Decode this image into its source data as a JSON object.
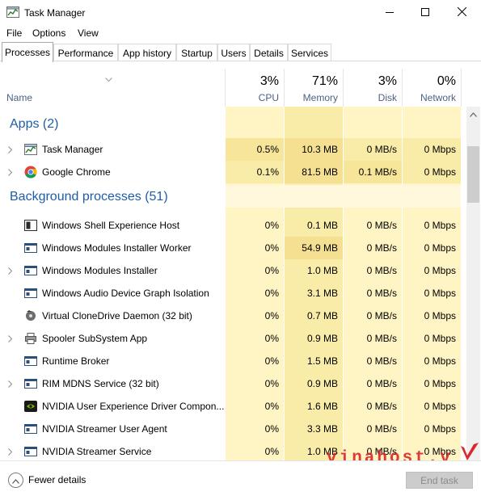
{
  "window": {
    "title": "Task Manager",
    "controls": [
      "minimize",
      "maximize",
      "close"
    ]
  },
  "menu": [
    "File",
    "Options",
    "View"
  ],
  "tabs": [
    {
      "label": "Processes",
      "active": true
    },
    {
      "label": "Performance",
      "active": false
    },
    {
      "label": "App history",
      "active": false
    },
    {
      "label": "Startup",
      "active": false
    },
    {
      "label": "Users",
      "active": false
    },
    {
      "label": "Details",
      "active": false
    },
    {
      "label": "Services",
      "active": false
    }
  ],
  "columns": {
    "name": "Name",
    "cpu": {
      "label": "CPU",
      "percent": "3%"
    },
    "memory": {
      "label": "Memory",
      "percent": "71%"
    },
    "disk": {
      "label": "Disk",
      "percent": "3%"
    },
    "network": {
      "label": "Network",
      "percent": "0%"
    }
  },
  "groups": {
    "apps": "Apps (2)",
    "background": "Background processes (51)"
  },
  "apps": [
    {
      "name": "Task Manager",
      "cpu": "0.5%",
      "memory": "10.3 MB",
      "disk": "0 MB/s",
      "network": "0 Mbps",
      "icon": "task-manager-icon",
      "expandable": true
    },
    {
      "name": "Google Chrome",
      "cpu": "0.1%",
      "memory": "81.5 MB",
      "disk": "0.1 MB/s",
      "network": "0 Mbps",
      "icon": "chrome-icon",
      "expandable": true
    }
  ],
  "background": [
    {
      "name": "Windows Shell Experience Host",
      "cpu": "0%",
      "memory": "0.1 MB",
      "disk": "0 MB/s",
      "network": "0 Mbps",
      "icon": "shell-host-icon",
      "expandable": false
    },
    {
      "name": "Windows Modules Installer Worker",
      "cpu": "0%",
      "memory": "54.9 MB",
      "disk": "0 MB/s",
      "network": "0 Mbps",
      "icon": "window-app-icon",
      "expandable": false
    },
    {
      "name": "Windows Modules Installer",
      "cpu": "0%",
      "memory": "1.0 MB",
      "disk": "0 MB/s",
      "network": "0 Mbps",
      "icon": "window-app-icon",
      "expandable": true
    },
    {
      "name": "Windows Audio Device Graph Isolation",
      "cpu": "0%",
      "memory": "3.1 MB",
      "disk": "0 MB/s",
      "network": "0 Mbps",
      "icon": "window-app-icon",
      "expandable": false
    },
    {
      "name": "Virtual CloneDrive Daemon (32 bit)",
      "cpu": "0%",
      "memory": "0.7 MB",
      "disk": "0 MB/s",
      "network": "0 Mbps",
      "icon": "clonedrive-icon",
      "expandable": false
    },
    {
      "name": "Spooler SubSystem App",
      "cpu": "0%",
      "memory": "0.9 MB",
      "disk": "0 MB/s",
      "network": "0 Mbps",
      "icon": "printer-icon",
      "expandable": true
    },
    {
      "name": "Runtime Broker",
      "cpu": "0%",
      "memory": "1.5 MB",
      "disk": "0 MB/s",
      "network": "0 Mbps",
      "icon": "window-app-icon",
      "expandable": false
    },
    {
      "name": "RIM MDNS Service (32 bit)",
      "cpu": "0%",
      "memory": "0.9 MB",
      "disk": "0 MB/s",
      "network": "0 Mbps",
      "icon": "window-app-icon",
      "expandable": true
    },
    {
      "name": "NVIDIA User Experience Driver Compon...",
      "cpu": "0%",
      "memory": "1.6 MB",
      "disk": "0 MB/s",
      "network": "0 Mbps",
      "icon": "nvidia-icon",
      "expandable": false
    },
    {
      "name": "NVIDIA Streamer User Agent",
      "cpu": "0%",
      "memory": "3.3 MB",
      "disk": "0 MB/s",
      "network": "0 Mbps",
      "icon": "window-app-icon",
      "expandable": false
    },
    {
      "name": "NVIDIA Streamer Service",
      "cpu": "0%",
      "memory": "1.0 MB",
      "disk": "0 MB/s",
      "network": "0 Mbps",
      "icon": "window-app-icon",
      "expandable": true
    }
  ],
  "footer": {
    "fewer_details": "Fewer details",
    "end_task": "End task"
  },
  "watermark": "vinahost.v",
  "colors": {
    "group_title": "#1e5da6",
    "header_label": "#4d6082",
    "heat_light": "#fff4c4",
    "heat_medium": "#f9eca8",
    "watermark": "#d9272e"
  }
}
